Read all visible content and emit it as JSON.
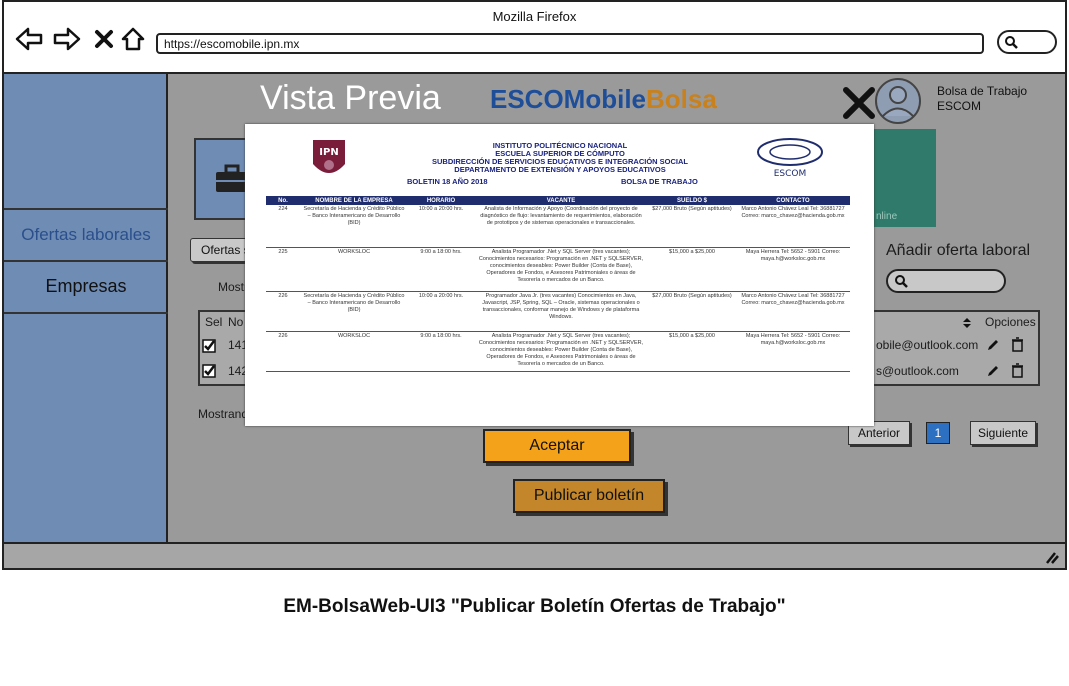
{
  "browser": {
    "window_title": "Mozilla Firefox",
    "url": "https://escomobile.ipn.mx",
    "icons": [
      "back-arrow-icon",
      "forward-arrow-icon",
      "close-icon",
      "home-icon",
      "search-icon"
    ]
  },
  "sidebar": {
    "items": [
      {
        "label": "Ofertas laborales",
        "active": true
      },
      {
        "label": "Empresas",
        "active": false
      }
    ]
  },
  "header": {
    "user_line1": "Bolsa de Trabajo",
    "user_line2": "ESCOM"
  },
  "background_page": {
    "tab_label": "Ofertas s",
    "showing_top": "Mostr",
    "add_offer": "Añadir oferta laboral",
    "table_headers": {
      "sel": "Sel",
      "no": "No",
      "options": "Opciones"
    },
    "rows": [
      {
        "no": "141",
        "email": "obile@outlook.com"
      },
      {
        "no": "142",
        "email": "s@outlook.com"
      }
    ],
    "showing_bottom": "Mostrand",
    "pagination": {
      "prev": "Anterior",
      "page": "1",
      "next": "Siguiente"
    },
    "tile_text": "nline"
  },
  "modal": {
    "title": "Vista Previa",
    "brand_part1": "ESCOMobile",
    "brand_part2": "Bolsa",
    "accept": "Aceptar",
    "publish": "Publicar boletín"
  },
  "document": {
    "header_lines": [
      "INSTITUTO POLITÉCNICO NACIONAL",
      "ESCUELA SUPERIOR DE CÓMPUTO",
      "SUBDIRECCIÓN DE SERVICIOS EDUCATIVOS E INTEGRACIÓN SOCIAL",
      "DEPARTAMENTO DE EXTENSIÓN Y APOYOS EDUCATIVOS"
    ],
    "bulletin_left": "BOLETIN 18 AÑO 2018",
    "bulletin_right": "BOLSA DE TRABAJO",
    "logo_left": "IPN",
    "logo_right": "ESCOM",
    "columns": [
      "No.",
      "NOMBRE DE LA EMPRESA",
      "HORARIO",
      "VACANTE",
      "SUELDO $",
      "CONTACTO"
    ],
    "rows": [
      [
        "224",
        "Secretaría de Hacienda y Crédito Público – Banco Interamericano de Desarrollo (BID)",
        "10:00 a 20:00 hrs.",
        "Analista de Información y Apoyo (Coordinación del proyecto de diagnóstico de flujo: levantamiento de requerimientos, elaboración de prototipos y de sistemas operacionales e transaccionales.",
        "$27,000 Bruto (Según aptitudes)",
        "Marco Antonio Chávez Leal Tel: 36881727 Correo: marco_chavez@hacienda.gob.mx"
      ],
      [
        "225",
        "WORKSLOC",
        "9:00 a 18:00 hrs.",
        "Analista Programador .Net y SQL Server (tres vacantes); Conocimientos necesarios: Programación en .NET y SQLSERVER, conocimientos deseables: Power Builder (Conta de Base), Operadores de Fondos, e Asesores Patrimoniales o áreas de Tesorería o mercados de un Banco.",
        "$15,000 a $25,000",
        "Maya Herrera Tel: 5652 - 5901 Correo: maya.h@worksloc.gob.mx"
      ],
      [
        "226",
        "Secretaría de Hacienda y Crédito Público – Banco Interamericano de Desarrollo (BID)",
        "10:00 a 20:00 hrs.",
        "Programador Java Jr. (tres vacantes) Conocimientos en Java, Javascript, JSP, Spring, SQL – Oracle, sistemas operacionales o transaccionales, conformar manejo de Windows y de plataforma Windows.",
        "$27,000 Bruto (Según aptitudes)",
        "Marco Antonio Chávez Leal Tel: 36881727 Correo: marco_chavez@hacienda.gob.mx"
      ],
      [
        "226",
        "WORKSLOC",
        "9:00 a 18:00 hrs.",
        "Analista Programador .Net y SQL Server (tres vacantes); Conocimientos necesarios: Programación en .NET y SQLSERVER, conocimientos deseables: Power Builder (Conta de Base), Operadores de Fondos, e Asesores Patrimoniales o áreas de Tesorería o mercados de un Banco.",
        "$15,000 a $25,000",
        "Maya Herrera Tel: 5652 - 5901 Correo: maya.h@worksloc.gob.mx"
      ]
    ]
  },
  "caption": "EM-BolsaWeb-UI3 \"Publicar Boletín Ofertas de Trabajo\""
}
